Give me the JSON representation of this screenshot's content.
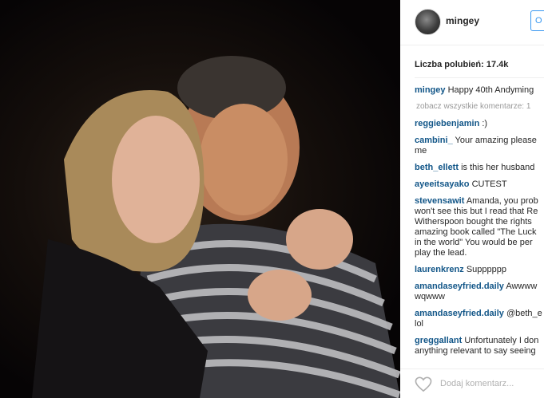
{
  "post": {
    "username": "mingey",
    "follow_label": "O",
    "likes_label": "Liczba polubień: 17.4k",
    "view_all_label": "zobacz wszystkie komentarze: 1",
    "caption": {
      "user": "mingey",
      "text": "Happy 40th Andyming"
    },
    "comments": [
      {
        "user": "reggiebenjamin",
        "text": ":)"
      },
      {
        "user": "cambini_",
        "text": "Your amazing please\nme"
      },
      {
        "user": "beth_ellett",
        "text": "is this her husband"
      },
      {
        "user": "ayeeitsayako",
        "text": "CUTEST"
      },
      {
        "user": "stevensawit",
        "text": "Amanda, you prob\nwon't see this but I read that Re\nWitherspoon bought the rights\namazing book called \"The Luck\nin the world\" You would be per\nplay the lead."
      },
      {
        "user": "laurenkrenz",
        "text": "Supppppp"
      },
      {
        "user": "amandaseyfried.daily",
        "text": "Awwww\nwqwww"
      },
      {
        "user": "amandaseyfried.daily",
        "text": "@beth_e\nlol"
      },
      {
        "user": "greggallant",
        "text": "Unfortunately I don\nanything relevant to say seeing"
      }
    ],
    "add_comment_placeholder": "Dodaj komentarz..."
  },
  "icons": {
    "like": "heart-icon"
  },
  "colors": {
    "username_link": "#125688",
    "follow_button": "#3897f0"
  }
}
